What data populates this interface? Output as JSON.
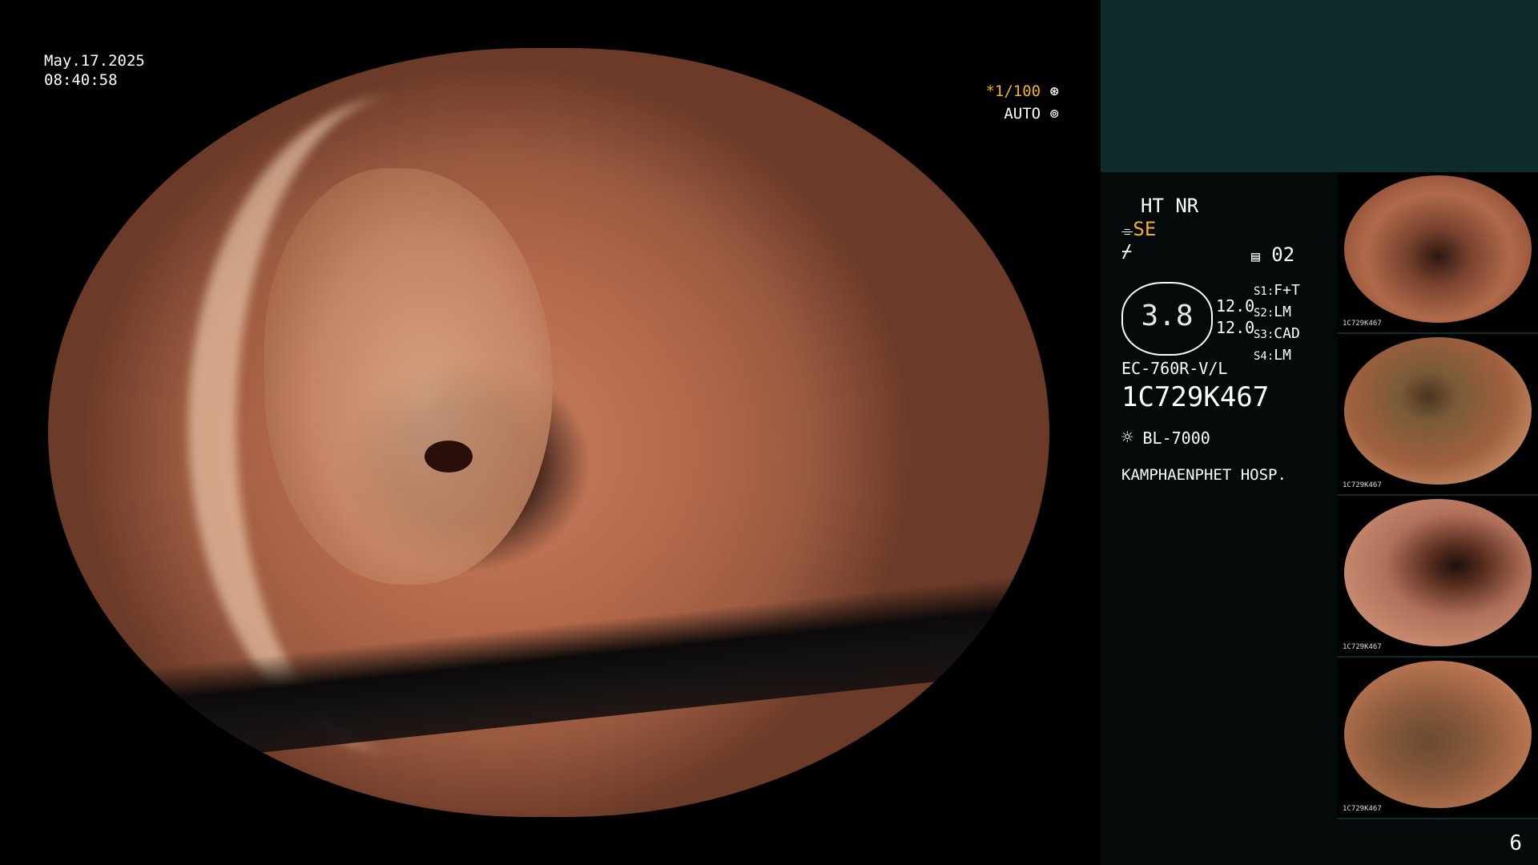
{
  "datetime": {
    "date": "May.17.2025",
    "time": "08:40:58"
  },
  "shutter": {
    "speed": "*1/100",
    "mode": "AUTO",
    "speed_icon": "aperture-icon",
    "mode_icon": "iris-icon"
  },
  "settings": {
    "enhancement": "HT NR",
    "structure_icon": "structure-enhance-icon",
    "structure": "SE",
    "color_icon": "color-mode-icon",
    "memory_icon": "memory-icon",
    "memory_slot": "02",
    "zoom_value": "3.8",
    "pressure_1": "12.0",
    "pressure_2": "12.0",
    "modes": [
      {
        "key": "S1:",
        "value": "F+T"
      },
      {
        "key": "S2:",
        "value": "LM"
      },
      {
        "key": "S3:",
        "value": "CAD"
      },
      {
        "key": "S4:",
        "value": "LM"
      }
    ]
  },
  "scope_model": "EC-760R-V/L",
  "scope_serial": "1C729K467",
  "light_icon": "light-source-icon",
  "light_source": "BL-7000",
  "hospital": "KAMPHAENPHET HOSP.",
  "thumbnails": [
    {
      "id": "1C729K467"
    },
    {
      "id": "1C729K467"
    },
    {
      "id": "1C729K467"
    },
    {
      "id": "1C729K467"
    }
  ],
  "page_number": "6",
  "colors": {
    "accent": "#f0b030",
    "panel_top": "#0e2b2b",
    "panel": "#040a0a"
  }
}
